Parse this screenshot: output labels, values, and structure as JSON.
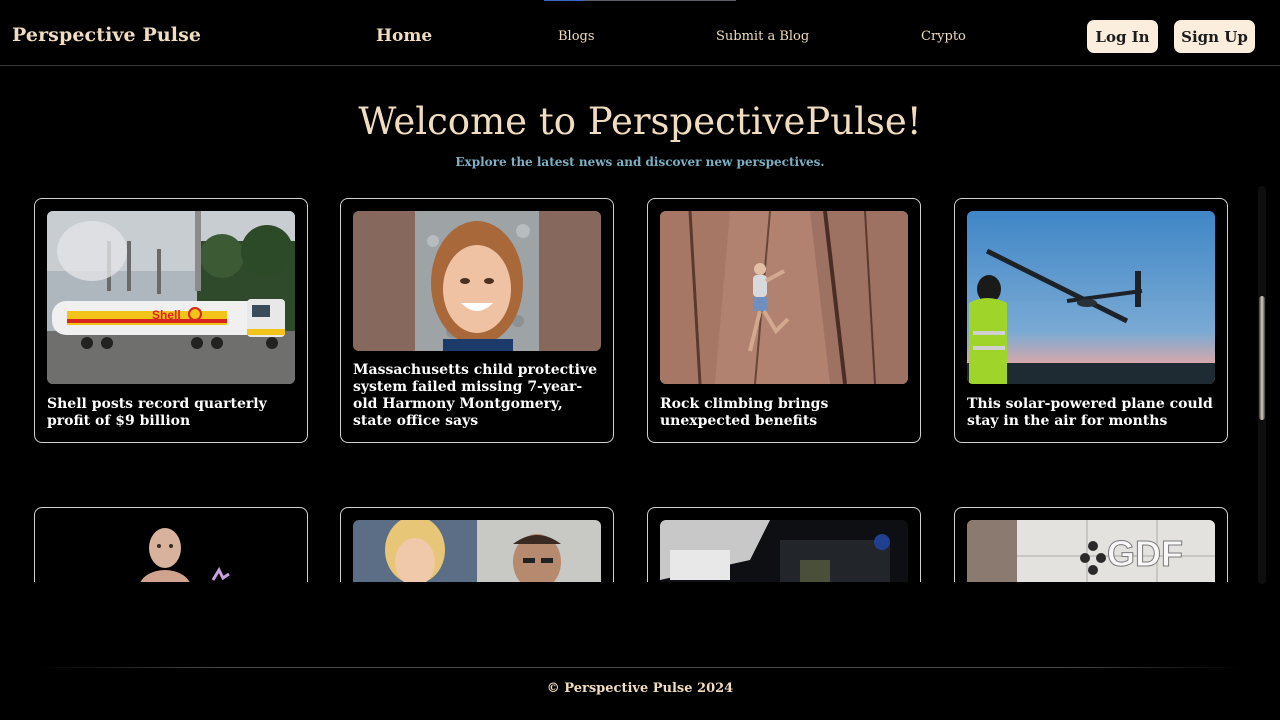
{
  "brand": "Perspective Pulse",
  "nav": {
    "home": "Home",
    "blogs": "Blogs",
    "submit": "Submit a Blog",
    "crypto": "Crypto"
  },
  "auth": {
    "login": "Log In",
    "signup": "Sign Up"
  },
  "hero": {
    "title": "Welcome to PerspectivePulse!",
    "subtitle": "Explore the latest news and discover new perspectives."
  },
  "articles": [
    {
      "title": "Shell posts record quarterly profit of $9 billion",
      "image": "shell-tanker-truck-image"
    },
    {
      "title": "Massachusetts child protective system failed missing 7-year-old Harmony Montgomery, state office says",
      "image": "child-portrait-image"
    },
    {
      "title": "Rock climbing brings unexpected benefits",
      "image": "rock-climber-image"
    },
    {
      "title": "This solar-powered plane could stay in the air for months",
      "image": "solar-plane-image"
    },
    {
      "title": "",
      "image": "baby-avatar-image"
    },
    {
      "title": "",
      "image": "mugshots-image"
    },
    {
      "title": "",
      "image": "space-capsule-image"
    },
    {
      "title": "",
      "image": "gdf-sign-image"
    }
  ],
  "footer": "© Perspective Pulse 2024",
  "colors": {
    "background": "#000000",
    "accent": "#f1dcbf",
    "subtitle": "#7db0c4",
    "button": "#fbeedc"
  }
}
